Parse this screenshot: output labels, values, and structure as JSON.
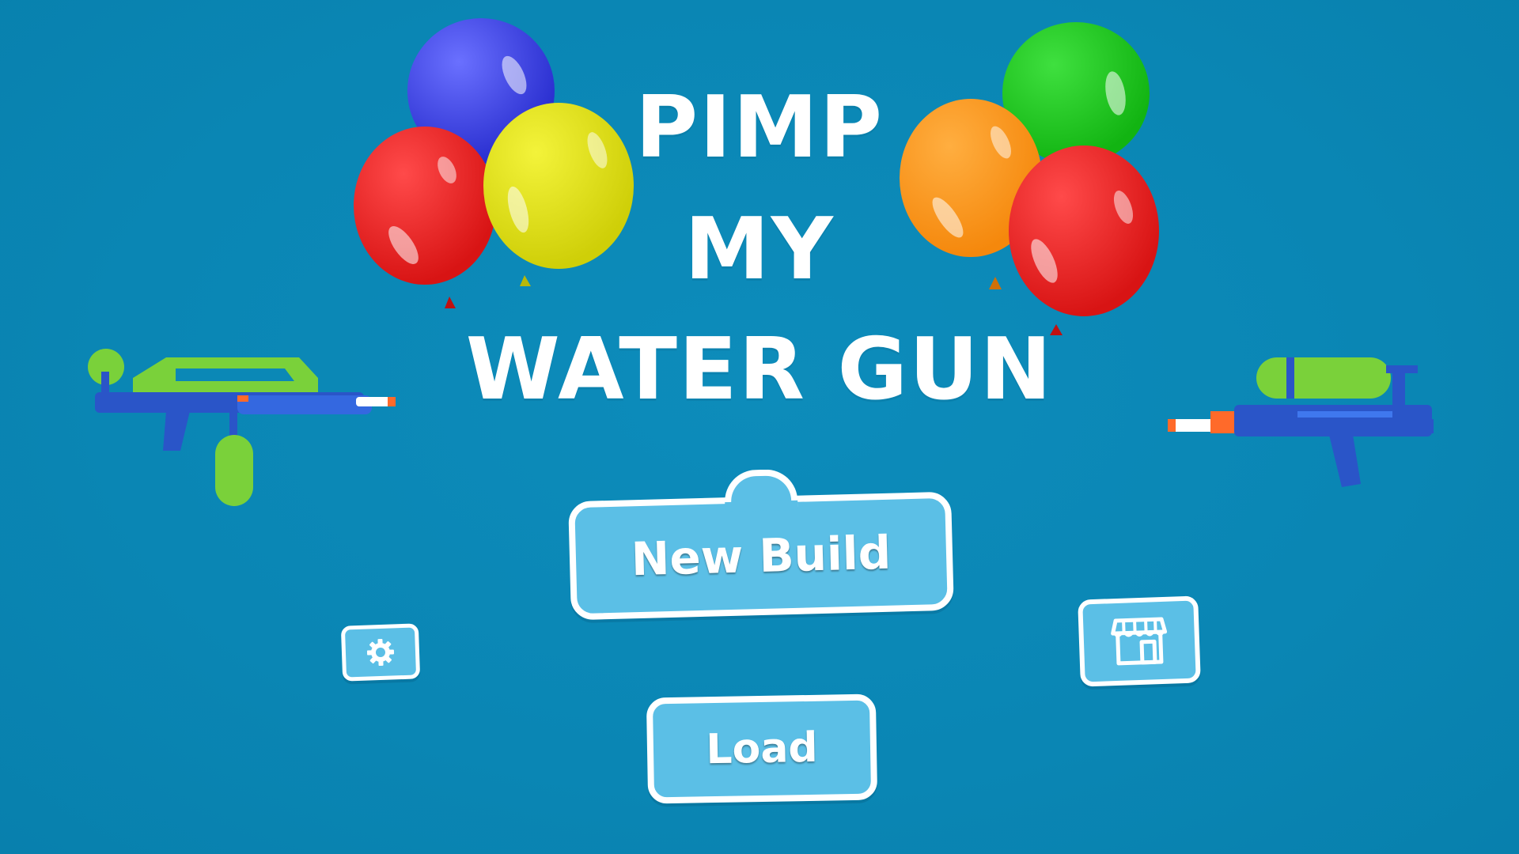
{
  "game": {
    "title_lines": [
      "PIMP",
      "MY",
      "WATER GUN"
    ]
  },
  "menu": {
    "new_build_label": "New Build",
    "load_label": "Load",
    "settings_icon": "gear-icon",
    "shop_icon": "shop-icon"
  },
  "colors": {
    "background": "#0b88b6",
    "button_fill": "#5bbfe6",
    "button_border": "#ffffff",
    "balloon_blue": "#3a3fe0",
    "balloon_red": "#ea1c1c",
    "balloon_yellow": "#dcdc10",
    "balloon_green": "#19c419",
    "balloon_orange": "#ff9418"
  }
}
